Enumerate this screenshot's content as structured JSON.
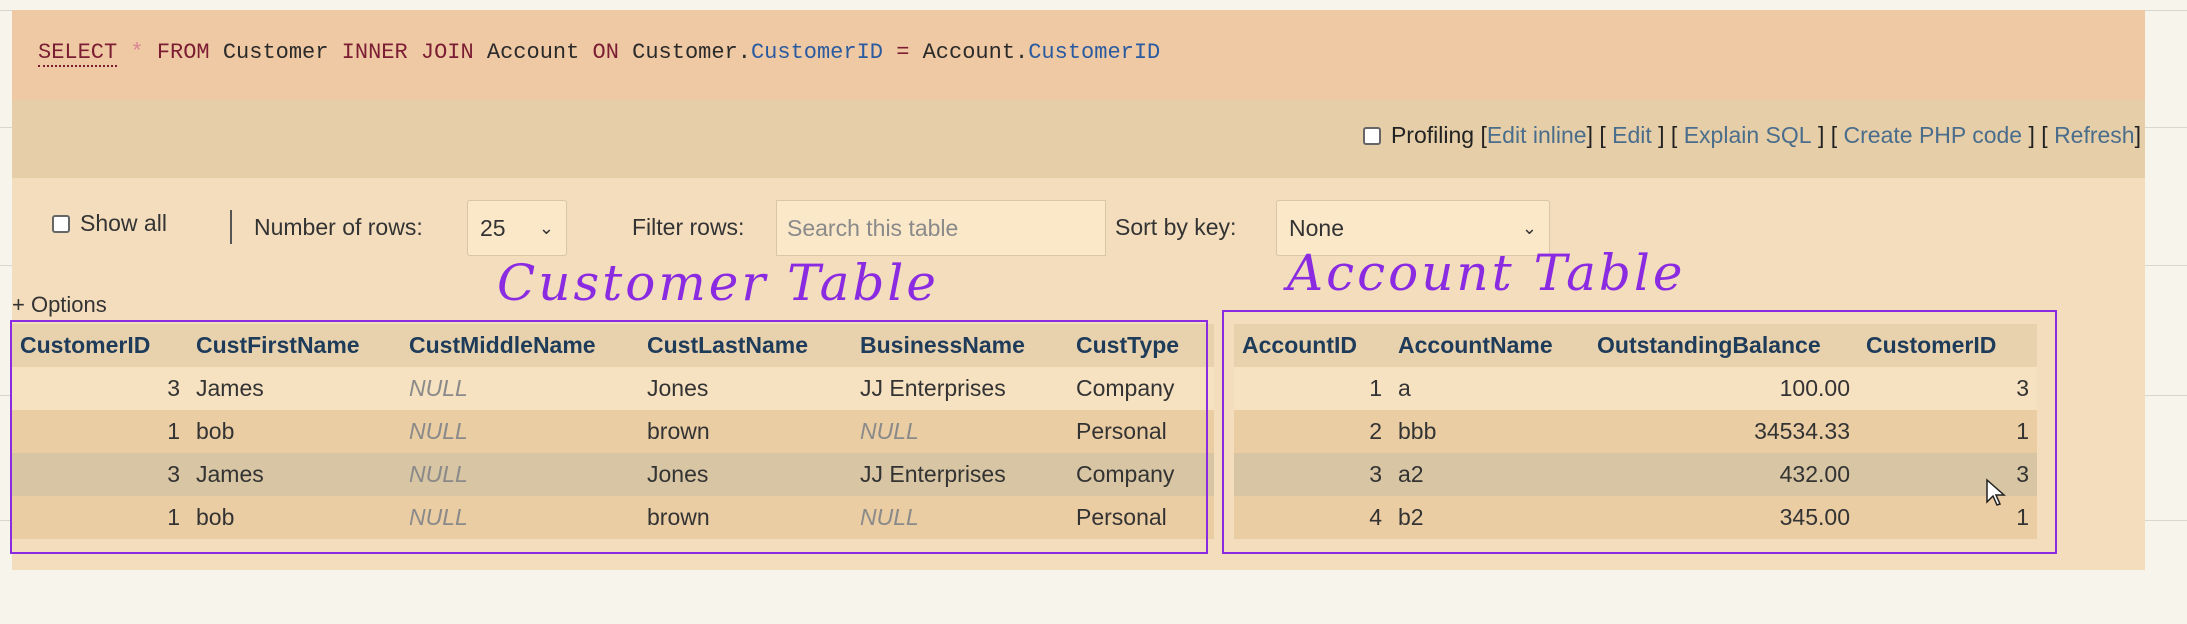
{
  "sql": {
    "select": "SELECT",
    "star": "*",
    "from": "FROM",
    "table1": "Customer",
    "join": "INNER JOIN",
    "table2": "Account",
    "on": "ON",
    "left_table": "Customer.",
    "left_field": "CustomerID",
    "eq": "=",
    "right_table": "Account.",
    "right_field": "CustomerID"
  },
  "actions": {
    "profiling": "Profiling",
    "open": "[",
    "edit_inline": "Edit inline",
    "edit": "Edit",
    "explain": "Explain SQL",
    "php": "Create PHP code",
    "refresh": "Refresh"
  },
  "controls": {
    "show_all": "Show all",
    "rows_label": "Number of rows:",
    "rows_value": "25",
    "filter_label": "Filter rows:",
    "filter_placeholder": "Search this table",
    "sort_label": "Sort by key:",
    "sort_value": "None"
  },
  "options_label": "+ Options",
  "annotations": {
    "customer": "Customer Table",
    "account": "Account Table"
  },
  "table": {
    "customer_headers": [
      "CustomerID",
      "CustFirstName",
      "CustMiddleName",
      "CustLastName",
      "BusinessName",
      "CustType"
    ],
    "account_headers": [
      "AccountID",
      "AccountName",
      "OutstandingBalance",
      "CustomerID"
    ],
    "rows": [
      {
        "c": [
          "3",
          "James",
          "NULL",
          "Jones",
          "JJ Enterprises",
          "Company"
        ],
        "a": [
          "1",
          "a",
          "100.00",
          "3"
        ]
      },
      {
        "c": [
          "1",
          "bob",
          "NULL",
          "brown",
          "NULL",
          "Personal"
        ],
        "a": [
          "2",
          "bbb",
          "34534.33",
          "1"
        ]
      },
      {
        "c": [
          "3",
          "James",
          "NULL",
          "Jones",
          "JJ Enterprises",
          "Company"
        ],
        "a": [
          "3",
          "a2",
          "432.00",
          "3"
        ]
      },
      {
        "c": [
          "1",
          "bob",
          "NULL",
          "brown",
          "NULL",
          "Personal"
        ],
        "a": [
          "4",
          "b2",
          "345.00",
          "1"
        ]
      }
    ]
  },
  "colors": {
    "annotation": "#8a2be2",
    "header_text": "#1e3b5a",
    "link": "#4a6d8c"
  }
}
